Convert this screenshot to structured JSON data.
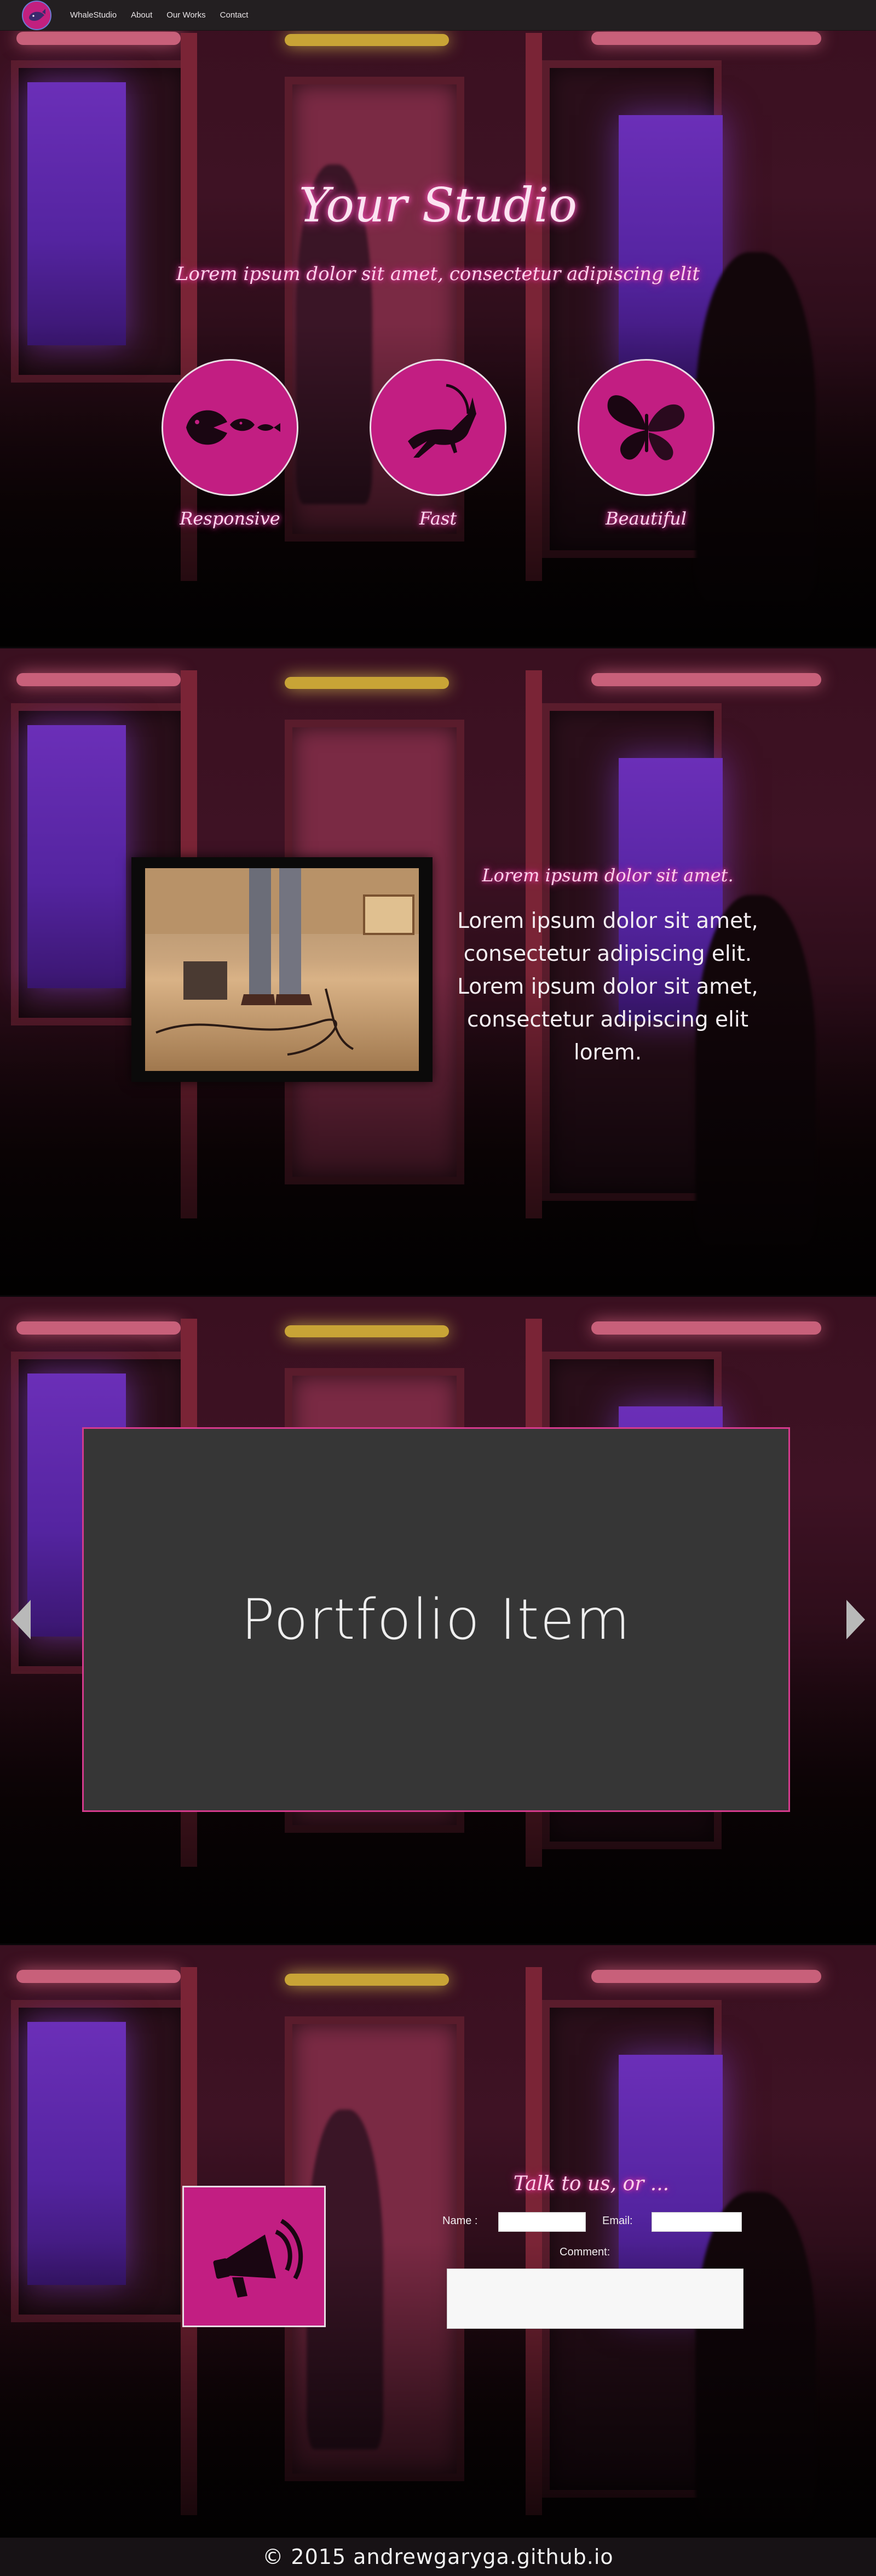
{
  "nav": {
    "logo_icon": "whale-logo-icon",
    "links": [
      "WhaleStudio",
      "About",
      "Our Works",
      "Contact"
    ]
  },
  "hero": {
    "title": "Your Studio",
    "subtitle": "Lorem ipsum dolor sit amet, consectetur adipiscing elit",
    "features": [
      {
        "label": "Responsive",
        "icon": "fish-chain-icon"
      },
      {
        "label": "Fast",
        "icon": "antelope-icon"
      },
      {
        "label": "Beautiful",
        "icon": "butterfly-icon"
      }
    ]
  },
  "about": {
    "heading": "Lorem ipsum dolor sit amet.",
    "text": "Lorem ipsum dolor sit amet, consectetur adipiscing elit. Lorem ipsum dolor sit amet, consectetur adipiscing elit lorem."
  },
  "portfolio": {
    "item_label": "Portfolio Item",
    "prev_icon": "arrow-left-icon",
    "next_icon": "arrow-right-icon"
  },
  "contact": {
    "heading": "Talk to us, or ...",
    "icon": "megaphone-icon",
    "name_label": "Name :",
    "name_value": "",
    "email_label": "Email:",
    "email_value": "",
    "comment_label": "Comment:",
    "comment_value": ""
  },
  "footer": {
    "text": "© 2015 andrewgaryga.github.io"
  },
  "colors": {
    "accent_magenta": "#c21e82",
    "neon_pink": "#ff3fb0",
    "nav_bg": "#231f21",
    "carousel_bg": "#363636",
    "carousel_border": "#d43a8c"
  }
}
